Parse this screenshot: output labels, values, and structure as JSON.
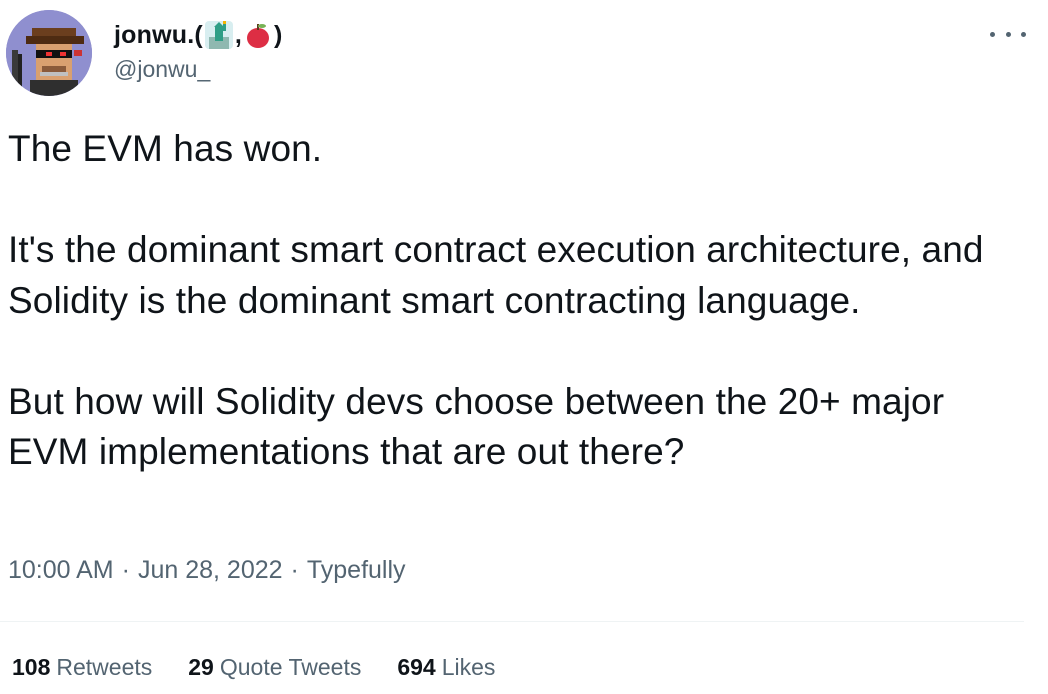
{
  "author": {
    "display_name_prefix": "jonwu.(",
    "display_name_sep": ",",
    "display_name_suffix": ")",
    "display_name_emojis": [
      "statue-of-liberty-icon",
      "red-apple-icon"
    ],
    "handle": "@jonwu_"
  },
  "tweet": {
    "paragraphs": [
      "The EVM has won.",
      "It's the dominant smart contract execution architecture, and Solidity is the dominant smart contracting language.",
      "But how will Solidity devs choose between the 20+ major EVM implementations that are out there?"
    ]
  },
  "meta": {
    "time": "10:00 AM",
    "separator": "·",
    "date": "Jun 28, 2022",
    "source": "Typefully"
  },
  "stats": {
    "retweets_count": "108",
    "retweets_label": "Retweets",
    "quotes_count": "29",
    "quotes_label": "Quote Tweets",
    "likes_count": "694",
    "likes_label": "Likes"
  },
  "colors": {
    "text": "#0f1419",
    "secondary": "#536471",
    "divider": "#eff3f4"
  }
}
